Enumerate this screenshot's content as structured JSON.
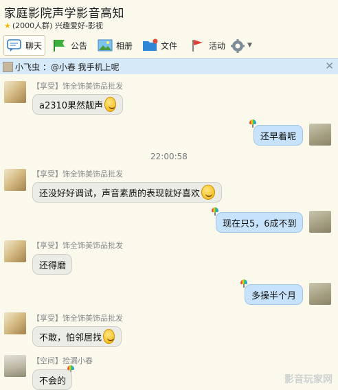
{
  "header": {
    "title": "家庭影院声学影音高知",
    "member_count": "(2000人群)",
    "tag": "兴趣爱好-影视"
  },
  "toolbar": {
    "chat": "聊天",
    "announce": "公告",
    "album": "相册",
    "files": "文件",
    "events": "活动"
  },
  "notice": {
    "text": "小飞虫 ：@小春 我手机上呢",
    "close": "✕"
  },
  "messages": [
    {
      "name": "【享受】饰全饰美饰品批发",
      "text": "a2310果然靓声"
    },
    {
      "text": "还早着呢"
    },
    {
      "time": "22:00:58"
    },
    {
      "name": "【享受】饰全饰美饰品批发",
      "text": "还没好好调试，声音素质的表现就好喜欢"
    },
    {
      "text": "现在只5，6成不到"
    },
    {
      "name": "【享受】饰全饰美饰品批发",
      "text": "还得磨"
    },
    {
      "text": "多操半个月"
    },
    {
      "name": "【享受】饰全饰美饰品批发",
      "text": "不敢，怕邻居找"
    },
    {
      "name": "【空间】捡漏小春",
      "text": "不会的"
    }
  ],
  "watermark": "影音玩家网",
  "colors": {
    "background": "#fbf8ec",
    "notice_bar": "#d6e9f8",
    "self_bubble": "#c7e3fb",
    "other_bubble": "#ecece6"
  }
}
